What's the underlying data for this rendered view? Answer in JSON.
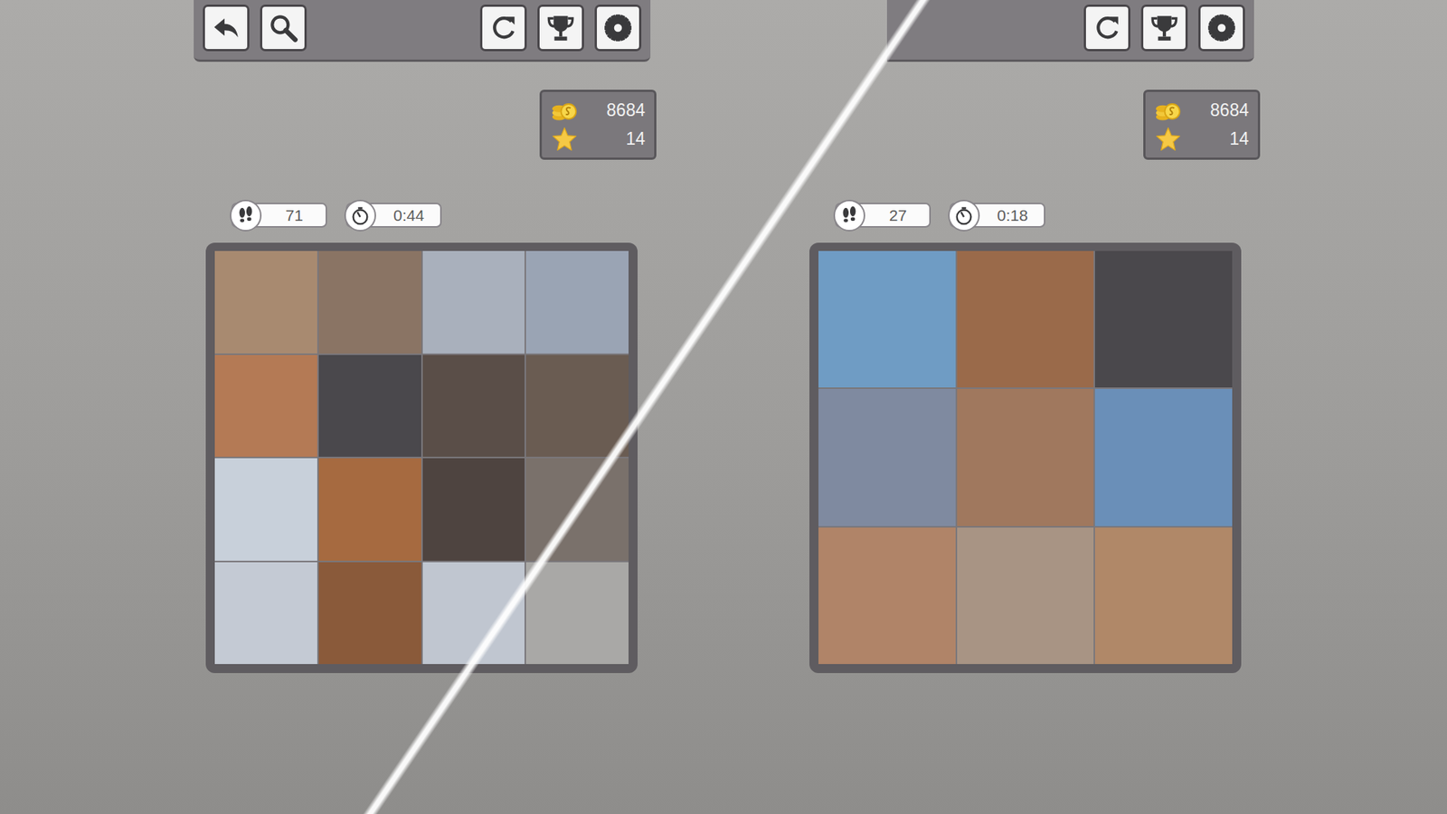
{
  "screens": [
    {
      "toolbar": {
        "left_buttons": [
          {
            "kind": "back"
          },
          {
            "kind": "search"
          }
        ],
        "right_buttons": [
          {
            "kind": "restart"
          },
          {
            "kind": "trophy"
          },
          {
            "kind": "settings"
          }
        ]
      },
      "coins": "8684",
      "stars": "14",
      "moves": "71",
      "time": "0:44",
      "tiles": [
        {
          "empty": false,
          "color": "#a88a70"
        },
        {
          "empty": false,
          "color": "#8a7464"
        },
        {
          "empty": false,
          "color": "#a9b0bc"
        },
        {
          "empty": false,
          "color": "#9aa4b4"
        },
        {
          "empty": false,
          "color": "#b47a55"
        },
        {
          "empty": true,
          "color": "#4a484c"
        },
        {
          "empty": false,
          "color": "#5a4e48"
        },
        {
          "empty": false,
          "color": "#6a5c52"
        },
        {
          "empty": false,
          "color": "#c8d0da"
        },
        {
          "empty": false,
          "color": "#a66a40"
        },
        {
          "empty": false,
          "color": "#4e4440"
        },
        {
          "empty": false,
          "color": "#7a716b"
        },
        {
          "empty": false,
          "color": "#c4cad4"
        },
        {
          "empty": false,
          "color": "#8a5a3a"
        },
        {
          "empty": false,
          "color": "#c0c6d0"
        },
        {
          "empty": false,
          "color": "#a9a8a6"
        }
      ]
    },
    {
      "toolbar": {
        "left_buttons": [],
        "right_buttons": [
          {
            "kind": "restart"
          },
          {
            "kind": "trophy"
          },
          {
            "kind": "settings"
          }
        ]
      },
      "coins": "8684",
      "stars": "14",
      "moves": "27",
      "time": "0:18",
      "tiles": [
        {
          "empty": false,
          "color": "#6f9cc4"
        },
        {
          "empty": false,
          "color": "#9a6a4a"
        },
        {
          "empty": true,
          "color": "#4a484c"
        },
        {
          "empty": false,
          "color": "#7f8aa0"
        },
        {
          "empty": false,
          "color": "#a0785e"
        },
        {
          "empty": false,
          "color": "#6a8fb8"
        },
        {
          "empty": false,
          "color": "#b08468"
        },
        {
          "empty": false,
          "color": "#a89484"
        },
        {
          "empty": false,
          "color": "#b08868"
        }
      ]
    }
  ]
}
